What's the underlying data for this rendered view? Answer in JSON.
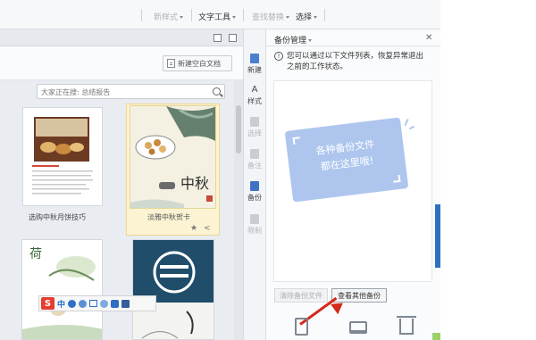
{
  "ribbon": {
    "items": [
      {
        "label": "新样式",
        "active": false
      },
      {
        "label": "文字工具",
        "active": true
      },
      {
        "label": "查找替换",
        "active": false
      },
      {
        "label": "选择",
        "active": true
      }
    ]
  },
  "new_doc": {
    "new_blank_label": "新建空白文档",
    "search_placeholder": "大家正在搜: 总结报告",
    "templates": [
      {
        "label": "选购中秋月饼技巧",
        "selected": false
      },
      {
        "label": "淡雅中秋贺卡",
        "selected": true
      },
      {
        "label": "",
        "selected": false
      },
      {
        "label": "",
        "selected": false
      }
    ],
    "card2_art_text": "中秋"
  },
  "sidebar": {
    "items": [
      {
        "label": "新建",
        "enabled": true
      },
      {
        "label": "样式",
        "enabled": true
      },
      {
        "label": "选择",
        "enabled": false
      },
      {
        "label": "备注",
        "enabled": false
      },
      {
        "label": "备份",
        "enabled": true
      },
      {
        "label": "限制",
        "enabled": false
      }
    ]
  },
  "backup_panel": {
    "title": "备份管理",
    "info_text": "您可以通过以下文件列表，恢复异常退出之前的工作状态。",
    "empty_note_line1": "各种备份文件",
    "empty_note_line2": "都在这里哦!",
    "clear_button": "清除备份文件",
    "view_other_button": "查看其他备份"
  },
  "ime": {
    "logo": "S",
    "mode": "中"
  },
  "colors": {
    "accent_blue": "#2f6fc0",
    "note_blue": "#aec6ee",
    "arrow_red": "#d42a1a",
    "selected_card": "#fbf3d2"
  }
}
